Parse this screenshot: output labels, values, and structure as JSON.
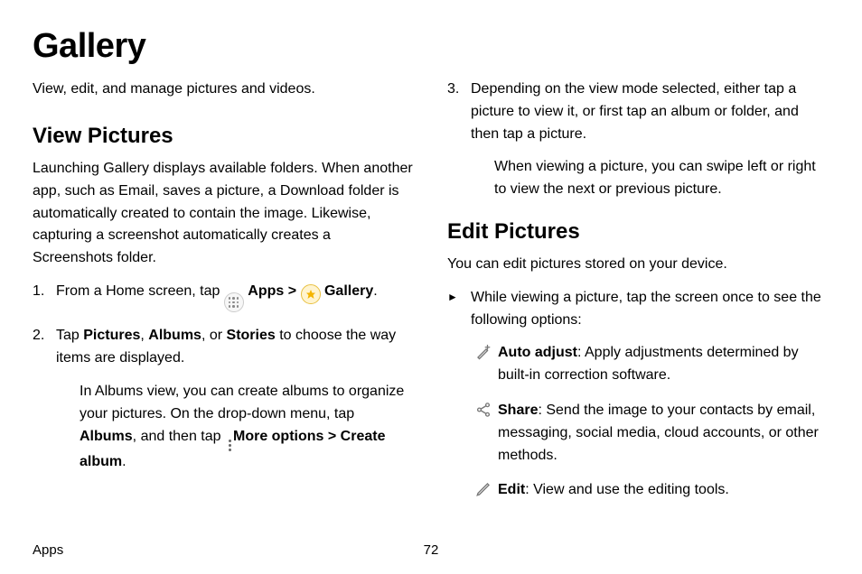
{
  "title": "Gallery",
  "intro": "View, edit, and manage pictures and videos.",
  "view_pictures": {
    "heading": "View Pictures",
    "para": "Launching Gallery displays available folders. When another app, such as Email, saves a picture, a Download folder is automatically created to contain the image. Likewise, capturing a screenshot automatically creates a Screenshots folder.",
    "step1_pre": "From a Home screen, tap ",
    "apps_label": "Apps",
    "chev": " > ",
    "gallery_label": "Gallery",
    "step1_post": ".",
    "step2_pre": "Tap ",
    "step2_pictures": "Pictures",
    "step2_sep1": ", ",
    "step2_albums": "Albums",
    "step2_sep2": ", or ",
    "step2_stories": "Stories",
    "step2_post": " to choose the way items are displayed.",
    "step2_sub_pre": "In Albums view, you can create albums to organize your pictures. On the drop-down menu, tap ",
    "step2_sub_albums": "Albums",
    "step2_sub_mid": ", and then tap ",
    "step2_sub_more": "More options",
    "step2_sub_chev": " > ",
    "step2_sub_create": "Create album",
    "step2_sub_post": ".",
    "step3": "Depending on the view mode selected, either tap a picture to view it, or first tap an album or folder, and then tap a picture.",
    "step3_sub": "When viewing a picture, you can swipe left or right to view the next or previous picture."
  },
  "edit_pictures": {
    "heading": "Edit Pictures",
    "para": "You can edit pictures stored on your device.",
    "arrow": "While viewing a picture, tap the screen once to see the following options:",
    "auto_label": "Auto adjust",
    "auto_text": ": Apply adjustments determined by built-in correction software.",
    "share_label": "Share",
    "share_text": ": Send the image to your contacts by email, messaging, social media, cloud accounts, or other methods.",
    "edit_label": "Edit",
    "edit_text": ": View and use the editing tools."
  },
  "footer": {
    "section": "Apps",
    "page": "72"
  }
}
